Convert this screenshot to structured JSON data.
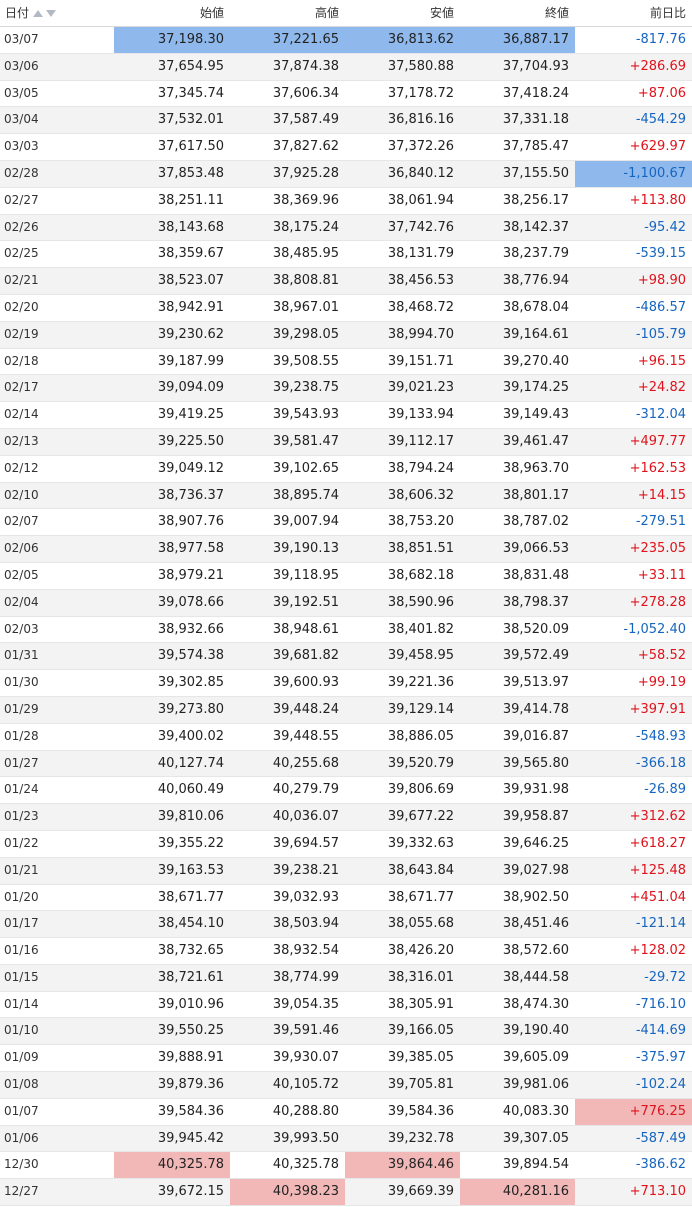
{
  "headers": {
    "date": "日付",
    "open": "始値",
    "high": "高値",
    "low": "安値",
    "close": "終値",
    "change": "前日比"
  },
  "colors": {
    "positive": "#e0121b",
    "negative": "#1565c0",
    "highlight_high": "#f2b8b8",
    "highlight_low": "#8fb9ec"
  },
  "rows": [
    {
      "date": "03/07",
      "open": "37,198.30",
      "high": "37,221.65",
      "low": "36,813.62",
      "close": "36,887.17",
      "change": "-817.76",
      "hl": {
        "open": "blue",
        "high": "blue",
        "low": "blue",
        "close": "blue"
      }
    },
    {
      "date": "03/06",
      "open": "37,654.95",
      "high": "37,874.38",
      "low": "37,580.88",
      "close": "37,704.93",
      "change": "+286.69"
    },
    {
      "date": "03/05",
      "open": "37,345.74",
      "high": "37,606.34",
      "low": "37,178.72",
      "close": "37,418.24",
      "change": "+87.06"
    },
    {
      "date": "03/04",
      "open": "37,532.01",
      "high": "37,587.49",
      "low": "36,816.16",
      "close": "37,331.18",
      "change": "-454.29"
    },
    {
      "date": "03/03",
      "open": "37,617.50",
      "high": "37,827.62",
      "low": "37,372.26",
      "close": "37,785.47",
      "change": "+629.97"
    },
    {
      "date": "02/28",
      "open": "37,853.48",
      "high": "37,925.28",
      "low": "36,840.12",
      "close": "37,155.50",
      "change": "-1,100.67",
      "hl": {
        "change": "blue"
      }
    },
    {
      "date": "02/27",
      "open": "38,251.11",
      "high": "38,369.96",
      "low": "38,061.94",
      "close": "38,256.17",
      "change": "+113.80"
    },
    {
      "date": "02/26",
      "open": "38,143.68",
      "high": "38,175.24",
      "low": "37,742.76",
      "close": "38,142.37",
      "change": "-95.42"
    },
    {
      "date": "02/25",
      "open": "38,359.67",
      "high": "38,485.95",
      "low": "38,131.79",
      "close": "38,237.79",
      "change": "-539.15"
    },
    {
      "date": "02/21",
      "open": "38,523.07",
      "high": "38,808.81",
      "low": "38,456.53",
      "close": "38,776.94",
      "change": "+98.90"
    },
    {
      "date": "02/20",
      "open": "38,942.91",
      "high": "38,967.01",
      "low": "38,468.72",
      "close": "38,678.04",
      "change": "-486.57"
    },
    {
      "date": "02/19",
      "open": "39,230.62",
      "high": "39,298.05",
      "low": "38,994.70",
      "close": "39,164.61",
      "change": "-105.79"
    },
    {
      "date": "02/18",
      "open": "39,187.99",
      "high": "39,508.55",
      "low": "39,151.71",
      "close": "39,270.40",
      "change": "+96.15"
    },
    {
      "date": "02/17",
      "open": "39,094.09",
      "high": "39,238.75",
      "low": "39,021.23",
      "close": "39,174.25",
      "change": "+24.82"
    },
    {
      "date": "02/14",
      "open": "39,419.25",
      "high": "39,543.93",
      "low": "39,133.94",
      "close": "39,149.43",
      "change": "-312.04"
    },
    {
      "date": "02/13",
      "open": "39,225.50",
      "high": "39,581.47",
      "low": "39,112.17",
      "close": "39,461.47",
      "change": "+497.77"
    },
    {
      "date": "02/12",
      "open": "39,049.12",
      "high": "39,102.65",
      "low": "38,794.24",
      "close": "38,963.70",
      "change": "+162.53"
    },
    {
      "date": "02/10",
      "open": "38,736.37",
      "high": "38,895.74",
      "low": "38,606.32",
      "close": "38,801.17",
      "change": "+14.15"
    },
    {
      "date": "02/07",
      "open": "38,907.76",
      "high": "39,007.94",
      "low": "38,753.20",
      "close": "38,787.02",
      "change": "-279.51"
    },
    {
      "date": "02/06",
      "open": "38,977.58",
      "high": "39,190.13",
      "low": "38,851.51",
      "close": "39,066.53",
      "change": "+235.05"
    },
    {
      "date": "02/05",
      "open": "38,979.21",
      "high": "39,118.95",
      "low": "38,682.18",
      "close": "38,831.48",
      "change": "+33.11"
    },
    {
      "date": "02/04",
      "open": "39,078.66",
      "high": "39,192.51",
      "low": "38,590.96",
      "close": "38,798.37",
      "change": "+278.28"
    },
    {
      "date": "02/03",
      "open": "38,932.66",
      "high": "38,948.61",
      "low": "38,401.82",
      "close": "38,520.09",
      "change": "-1,052.40"
    },
    {
      "date": "01/31",
      "open": "39,574.38",
      "high": "39,681.82",
      "low": "39,458.95",
      "close": "39,572.49",
      "change": "+58.52"
    },
    {
      "date": "01/30",
      "open": "39,302.85",
      "high": "39,600.93",
      "low": "39,221.36",
      "close": "39,513.97",
      "change": "+99.19"
    },
    {
      "date": "01/29",
      "open": "39,273.80",
      "high": "39,448.24",
      "low": "39,129.14",
      "close": "39,414.78",
      "change": "+397.91"
    },
    {
      "date": "01/28",
      "open": "39,400.02",
      "high": "39,448.55",
      "low": "38,886.05",
      "close": "39,016.87",
      "change": "-548.93"
    },
    {
      "date": "01/27",
      "open": "40,127.74",
      "high": "40,255.68",
      "low": "39,520.79",
      "close": "39,565.80",
      "change": "-366.18"
    },
    {
      "date": "01/24",
      "open": "40,060.49",
      "high": "40,279.79",
      "low": "39,806.69",
      "close": "39,931.98",
      "change": "-26.89"
    },
    {
      "date": "01/23",
      "open": "39,810.06",
      "high": "40,036.07",
      "low": "39,677.22",
      "close": "39,958.87",
      "change": "+312.62"
    },
    {
      "date": "01/22",
      "open": "39,355.22",
      "high": "39,694.57",
      "low": "39,332.63",
      "close": "39,646.25",
      "change": "+618.27"
    },
    {
      "date": "01/21",
      "open": "39,163.53",
      "high": "39,238.21",
      "low": "38,643.84",
      "close": "39,027.98",
      "change": "+125.48"
    },
    {
      "date": "01/20",
      "open": "38,671.77",
      "high": "39,032.93",
      "low": "38,671.77",
      "close": "38,902.50",
      "change": "+451.04"
    },
    {
      "date": "01/17",
      "open": "38,454.10",
      "high": "38,503.94",
      "low": "38,055.68",
      "close": "38,451.46",
      "change": "-121.14"
    },
    {
      "date": "01/16",
      "open": "38,732.65",
      "high": "38,932.54",
      "low": "38,426.20",
      "close": "38,572.60",
      "change": "+128.02"
    },
    {
      "date": "01/15",
      "open": "38,721.61",
      "high": "38,774.99",
      "low": "38,316.01",
      "close": "38,444.58",
      "change": "-29.72"
    },
    {
      "date": "01/14",
      "open": "39,010.96",
      "high": "39,054.35",
      "low": "38,305.91",
      "close": "38,474.30",
      "change": "-716.10"
    },
    {
      "date": "01/10",
      "open": "39,550.25",
      "high": "39,591.46",
      "low": "39,166.05",
      "close": "39,190.40",
      "change": "-414.69"
    },
    {
      "date": "01/09",
      "open": "39,888.91",
      "high": "39,930.07",
      "low": "39,385.05",
      "close": "39,605.09",
      "change": "-375.97"
    },
    {
      "date": "01/08",
      "open": "39,879.36",
      "high": "40,105.72",
      "low": "39,705.81",
      "close": "39,981.06",
      "change": "-102.24"
    },
    {
      "date": "01/07",
      "open": "39,584.36",
      "high": "40,288.80",
      "low": "39,584.36",
      "close": "40,083.30",
      "change": "+776.25",
      "hl": {
        "change": "red"
      }
    },
    {
      "date": "01/06",
      "open": "39,945.42",
      "high": "39,993.50",
      "low": "39,232.78",
      "close": "39,307.05",
      "change": "-587.49"
    },
    {
      "date": "12/30",
      "open": "40,325.78",
      "high": "40,325.78",
      "low": "39,864.46",
      "close": "39,894.54",
      "change": "-386.62",
      "hl": {
        "open": "red",
        "low": "red"
      }
    },
    {
      "date": "12/27",
      "open": "39,672.15",
      "high": "40,398.23",
      "low": "39,669.39",
      "close": "40,281.16",
      "change": "+713.10",
      "hl": {
        "high": "red",
        "close": "red"
      }
    }
  ]
}
